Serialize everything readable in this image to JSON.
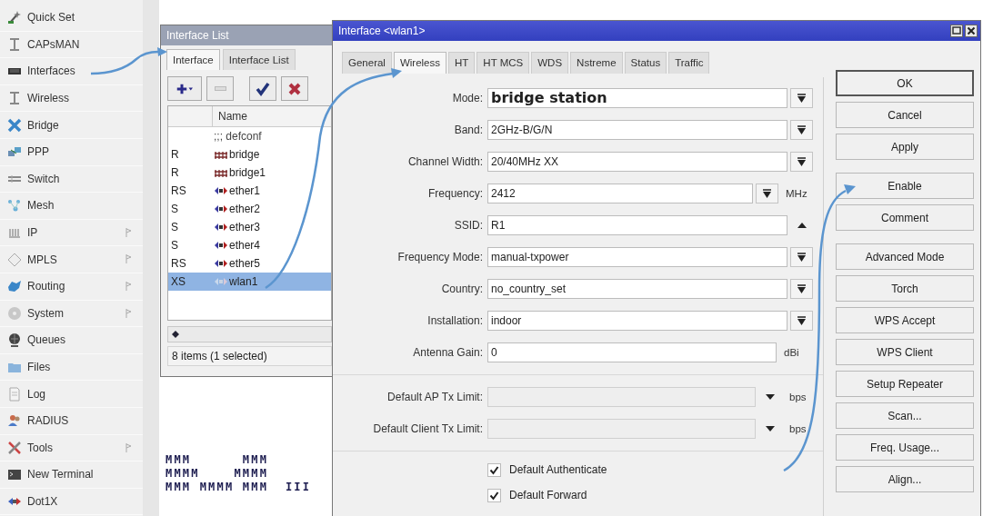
{
  "sidebar": {
    "items": [
      {
        "label": "Quick Set",
        "has_submenu": false
      },
      {
        "label": "CAPsMAN",
        "has_submenu": false
      },
      {
        "label": "Interfaces",
        "has_submenu": false
      },
      {
        "label": "Wireless",
        "has_submenu": false
      },
      {
        "label": "Bridge",
        "has_submenu": false
      },
      {
        "label": "PPP",
        "has_submenu": false
      },
      {
        "label": "Switch",
        "has_submenu": false
      },
      {
        "label": "Mesh",
        "has_submenu": false
      },
      {
        "label": "IP",
        "has_submenu": true
      },
      {
        "label": "MPLS",
        "has_submenu": true
      },
      {
        "label": "Routing",
        "has_submenu": true
      },
      {
        "label": "System",
        "has_submenu": true
      },
      {
        "label": "Queues",
        "has_submenu": false
      },
      {
        "label": "Files",
        "has_submenu": false
      },
      {
        "label": "Log",
        "has_submenu": false
      },
      {
        "label": "RADIUS",
        "has_submenu": false
      },
      {
        "label": "Tools",
        "has_submenu": true
      },
      {
        "label": "New Terminal",
        "has_submenu": false
      },
      {
        "label": "Dot1X",
        "has_submenu": false
      }
    ]
  },
  "interface_list": {
    "title": "Interface List",
    "tabs": [
      {
        "label": "Interface",
        "selected": true
      },
      {
        "label": "Interface List",
        "selected": false
      }
    ],
    "columns": [
      "Name"
    ],
    "comment": ";;; defconf",
    "rows": [
      {
        "flags": "R",
        "name": "bridge",
        "kind": "bridge",
        "selected": false
      },
      {
        "flags": "R",
        "name": "bridge1",
        "kind": "bridge",
        "selected": false
      },
      {
        "flags": "RS",
        "name": "ether1",
        "kind": "ethernet",
        "selected": false
      },
      {
        "flags": "S",
        "name": "ether2",
        "kind": "ethernet",
        "selected": false
      },
      {
        "flags": "S",
        "name": "ether3",
        "kind": "ethernet",
        "selected": false
      },
      {
        "flags": "S",
        "name": "ether4",
        "kind": "ethernet",
        "selected": false
      },
      {
        "flags": "RS",
        "name": "ether5",
        "kind": "ethernet",
        "selected": false
      },
      {
        "flags": "XS",
        "name": "wlan1",
        "kind": "wireless",
        "selected": true
      }
    ],
    "status": "8 items (1 selected)"
  },
  "console": {
    "lines": [
      "MMM      MMM",
      "MMMM    MMMM",
      "MMM MMMM MMM  III"
    ]
  },
  "wlan_window": {
    "title": "Interface <wlan1>",
    "tabs": [
      {
        "label": "General",
        "selected": false
      },
      {
        "label": "Wireless",
        "selected": true
      },
      {
        "label": "HT",
        "selected": false
      },
      {
        "label": "HT MCS",
        "selected": false
      },
      {
        "label": "WDS",
        "selected": false
      },
      {
        "label": "Nstreme",
        "selected": false
      },
      {
        "label": "Status",
        "selected": false
      },
      {
        "label": "Traffic",
        "selected": false
      }
    ],
    "fields": [
      {
        "kind": "select",
        "label": "Mode:",
        "value": "bridge station",
        "emphasized": true,
        "disabled": false
      },
      {
        "kind": "select",
        "label": "Band:",
        "value": "2GHz-B/G/N",
        "emphasized": false,
        "disabled": false
      },
      {
        "kind": "select",
        "label": "Channel Width:",
        "value": "20/40MHz XX",
        "emphasized": false,
        "disabled": false
      },
      {
        "kind": "select",
        "label": "Frequency:",
        "value": "2412",
        "unit": "MHz",
        "emphasized": false,
        "disabled": false
      },
      {
        "kind": "text_up",
        "label": "SSID:",
        "value": "R1",
        "emphasized": false,
        "disabled": false
      },
      {
        "kind": "select",
        "label": "Frequency Mode:",
        "value": "manual-txpower",
        "emphasized": false,
        "disabled": false
      },
      {
        "kind": "select",
        "label": "Country:",
        "value": "no_country_set",
        "emphasized": false,
        "disabled": false
      },
      {
        "kind": "select",
        "label": "Installation:",
        "value": "indoor",
        "emphasized": false,
        "disabled": false
      },
      {
        "kind": "text",
        "label": "Antenna Gain:",
        "value": "0",
        "unit": "dBi",
        "emphasized": false,
        "disabled": false
      },
      {
        "kind": "separator"
      },
      {
        "kind": "limit",
        "label": "Default AP Tx Limit:",
        "unit": "bps",
        "emphasized": false,
        "disabled": true
      },
      {
        "kind": "limit",
        "label": "Default Client Tx Limit:",
        "unit": "bps",
        "emphasized": false,
        "disabled": true
      },
      {
        "kind": "separator"
      },
      {
        "kind": "checkbox",
        "label": "Default Authenticate",
        "checked": true
      },
      {
        "kind": "checkbox",
        "label": "Default Forward",
        "checked": true
      }
    ],
    "button_groups": [
      [
        {
          "label": "OK",
          "default": true
        },
        {
          "label": "Cancel",
          "default": false
        },
        {
          "label": "Apply",
          "default": false
        }
      ],
      [
        {
          "label": "Enable",
          "default": false
        },
        {
          "label": "Comment",
          "default": false
        }
      ],
      [
        {
          "label": "Advanced Mode",
          "default": false
        },
        {
          "label": "Torch",
          "default": false
        },
        {
          "label": "WPS Accept",
          "default": false
        },
        {
          "label": "WPS Client",
          "default": false
        },
        {
          "label": "Setup Repeater",
          "default": false
        },
        {
          "label": "Scan...",
          "default": false
        },
        {
          "label": "Freq. Usage...",
          "default": false
        },
        {
          "label": "Align...",
          "default": false
        }
      ]
    ]
  }
}
